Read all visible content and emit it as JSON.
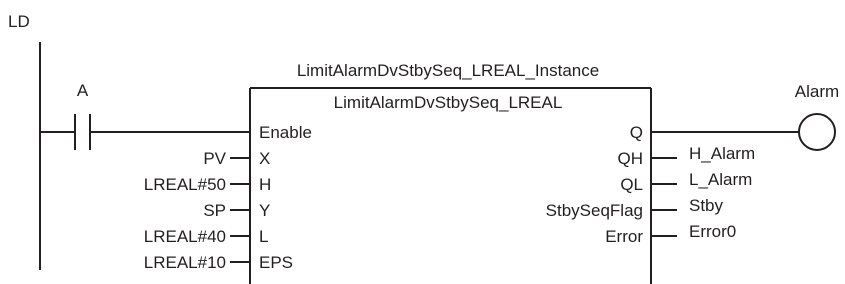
{
  "language_label": "LD",
  "instance_name": "LimitAlarmDvStbySeq_LREAL_Instance",
  "function_block": {
    "type_name": "LimitAlarmDvStbySeq_LREAL",
    "inputs": [
      {
        "name": "Enable",
        "argument": ""
      },
      {
        "name": "X",
        "argument": "PV"
      },
      {
        "name": "H",
        "argument": "LREAL#50"
      },
      {
        "name": "Y",
        "argument": "SP"
      },
      {
        "name": "L",
        "argument": "LREAL#40"
      },
      {
        "name": "EPS",
        "argument": "LREAL#10"
      }
    ],
    "outputs": [
      {
        "name": "Q",
        "argument": ""
      },
      {
        "name": "QH",
        "argument": "H_Alarm"
      },
      {
        "name": "QL",
        "argument": "L_Alarm"
      },
      {
        "name": "StbySeqFlag",
        "argument": "Stby"
      },
      {
        "name": "Error",
        "argument": "Error0"
      }
    ]
  },
  "contact": {
    "label": "A"
  },
  "coil": {
    "label": "Alarm"
  }
}
